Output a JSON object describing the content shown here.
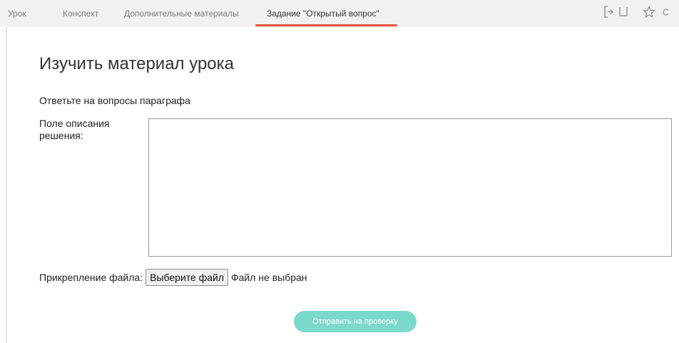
{
  "tabs": [
    {
      "label": "Урок",
      "active": false
    },
    {
      "label": "Конспект",
      "active": false
    },
    {
      "label": "Дополнительные материалы",
      "active": false
    },
    {
      "label": "Задание \"Открытый вопрос\"",
      "active": true
    }
  ],
  "toolbar_icons": [
    "exit-icon",
    "bookmark-icon",
    "star-icon",
    "circle-icon"
  ],
  "accent_color": "#e8553f",
  "submit_color": "#7dd8cc",
  "main": {
    "title": "Изучить материал урока",
    "subtitle": "Ответьте на вопросы параграфа",
    "solution_label": "Поле описания решения:",
    "solution_value": "",
    "file_label": "Прикрепление файла:",
    "file_button": "Выберите файл",
    "file_status": "Файл не выбран",
    "submit_label": "Отправить на проверку"
  }
}
